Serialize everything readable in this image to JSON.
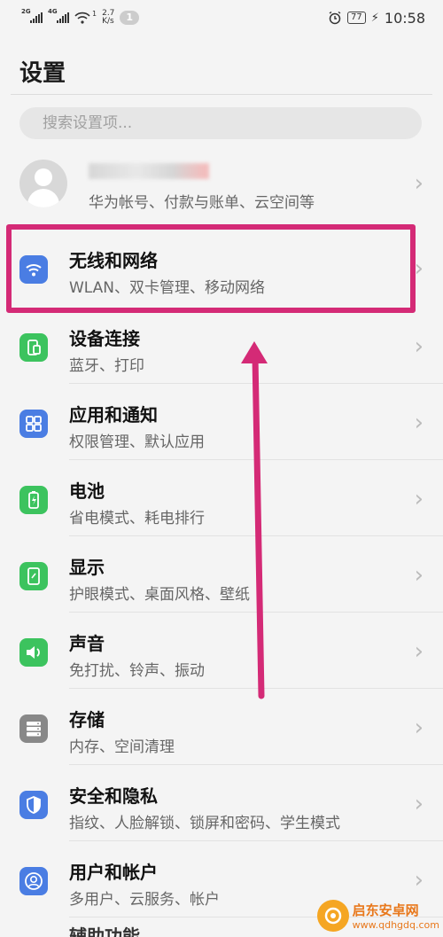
{
  "status_bar": {
    "sim1_tag": "2G",
    "sim2_tag": "4G",
    "speed_value": "2.7",
    "speed_unit": "K/s",
    "wifi_badge": "1",
    "notification_count": "1",
    "battery": "77",
    "time": "10:58"
  },
  "header": {
    "title": "设置"
  },
  "search": {
    "placeholder": "搜索设置项..."
  },
  "account": {
    "subtitle": "华为帐号、付款与账单、云空间等"
  },
  "settings": [
    {
      "title": "无线和网络",
      "subtitle": "WLAN、双卡管理、移动网络",
      "icon": "wifi-icon",
      "color": "#4a7de3"
    },
    {
      "title": "设备连接",
      "subtitle": "蓝牙、打印",
      "icon": "device-connection-icon",
      "color": "#3cc35e"
    },
    {
      "title": "应用和通知",
      "subtitle": "权限管理、默认应用",
      "icon": "apps-grid-icon",
      "color": "#4a7de3"
    },
    {
      "title": "电池",
      "subtitle": "省电模式、耗电排行",
      "icon": "battery-icon",
      "color": "#3cc35e"
    },
    {
      "title": "显示",
      "subtitle": "护眼模式、桌面风格、壁纸",
      "icon": "display-icon",
      "color": "#3cc35e"
    },
    {
      "title": "声音",
      "subtitle": "免打扰、铃声、振动",
      "icon": "sound-icon",
      "color": "#3cc35e"
    },
    {
      "title": "存储",
      "subtitle": "内存、空间清理",
      "icon": "storage-icon",
      "color": "#888888"
    },
    {
      "title": "安全和隐私",
      "subtitle": "指纹、人脸解锁、锁屏和密码、学生模式",
      "icon": "shield-icon",
      "color": "#4a7de3"
    },
    {
      "title": "用户和帐户",
      "subtitle": "多用户、云服务、帐户",
      "icon": "user-account-icon",
      "color": "#4a7de3"
    }
  ],
  "partial_next": "辅助功能",
  "annotation": {
    "highlight_color": "#d42a76"
  },
  "watermark": {
    "name": "启东安卓网",
    "url": "www.qdhgdq.com"
  }
}
